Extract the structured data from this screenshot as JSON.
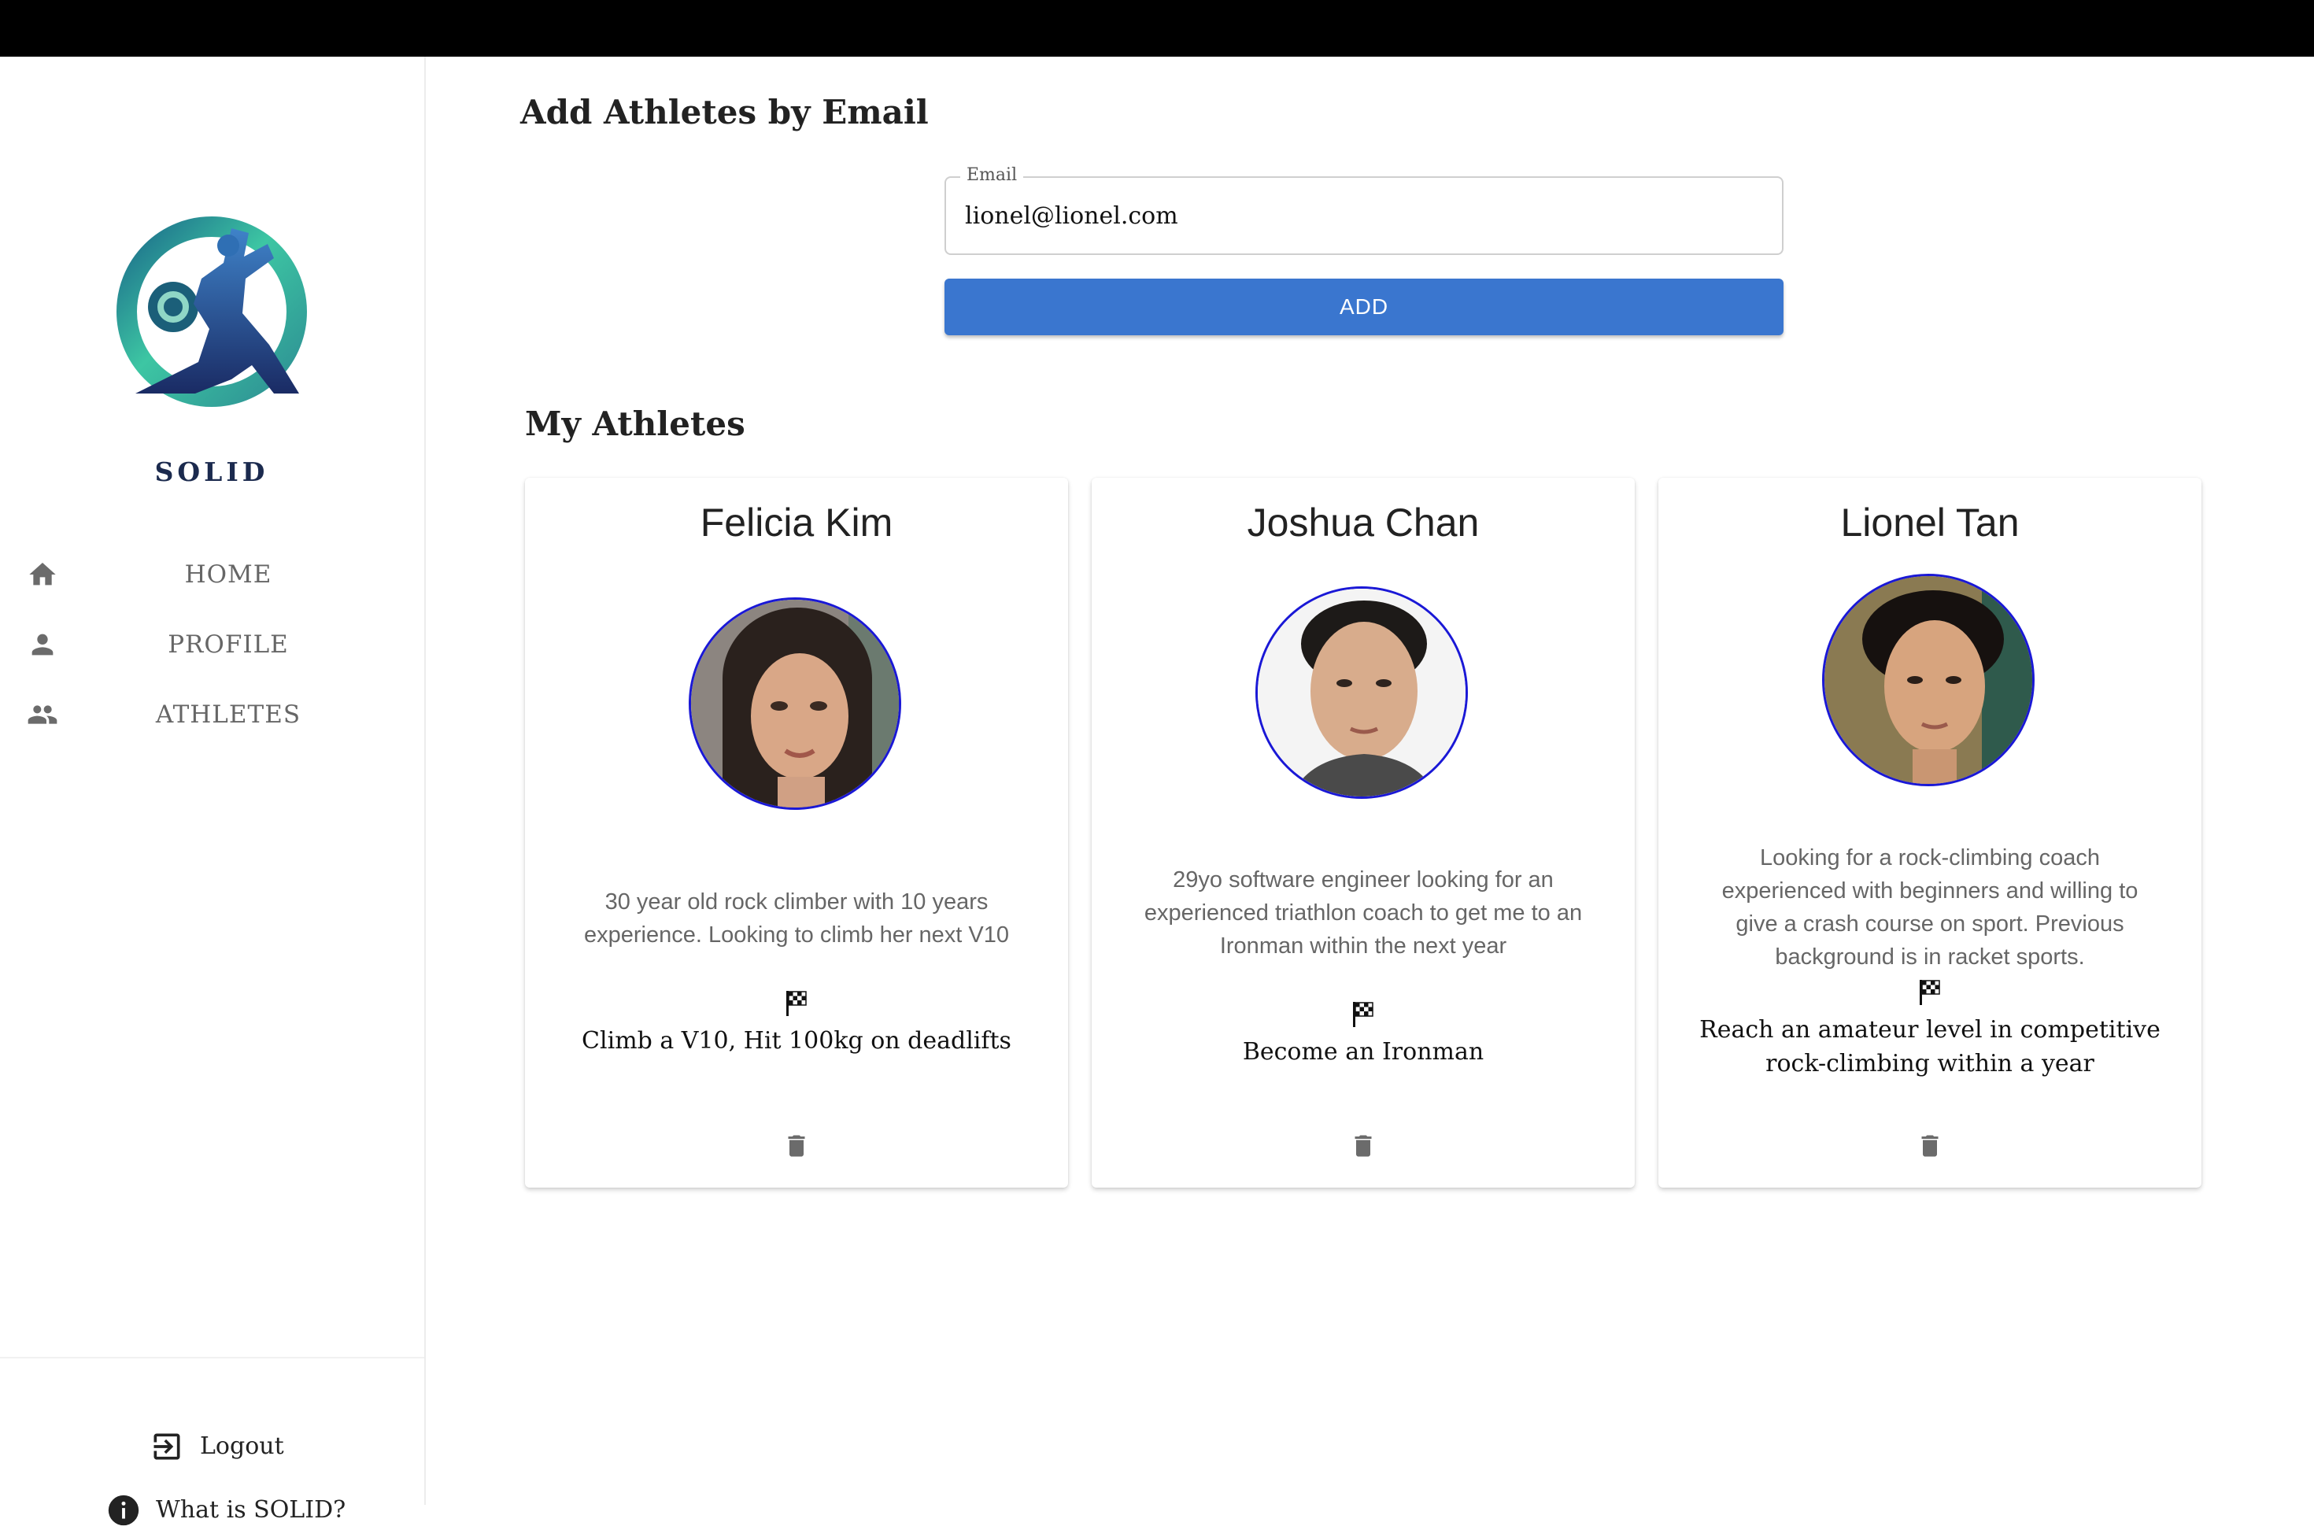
{
  "app": {
    "brand": "SOLID"
  },
  "nav": {
    "home": "HOME",
    "profile": "PROFILE",
    "athletes": "ATHLETES"
  },
  "footer": {
    "logout": "Logout",
    "about": "What is SOLID?"
  },
  "add_section": {
    "title": "Add Athletes by Email",
    "email_label": "Email",
    "email_value": "lionel@lionel.com",
    "add_button": "ADD"
  },
  "athletes_section": {
    "title": "My Athletes"
  },
  "athletes": [
    {
      "name": "Felicia Kim",
      "description": "30 year old rock climber with 10 years experience. Looking to climb her next V10",
      "goal": "Climb a V10, Hit 100kg on deadlifts"
    },
    {
      "name": "Joshua Chan",
      "description": "29yo software engineer looking for an experienced triathlon coach to get me to an Ironman within the next year",
      "goal": "Become an Ironman"
    },
    {
      "name": "Lionel Tan",
      "description": "Looking for a rock-climbing coach experienced with beginners and willing to give a crash course on sport. Previous background is in racket sports.",
      "goal": "Reach an amateur level in competitive rock-climbing within a year"
    }
  ],
  "icons": {
    "nav": [
      "home-icon",
      "person-icon",
      "group-icon"
    ],
    "footer": [
      "logout-icon",
      "info-icon"
    ],
    "card": [
      "checkered-flag-icon",
      "trash-icon"
    ]
  },
  "colors": {
    "primary": "#3a76cf",
    "avatar_border": "#1a18d6",
    "brand_text": "#1b2a4e"
  }
}
